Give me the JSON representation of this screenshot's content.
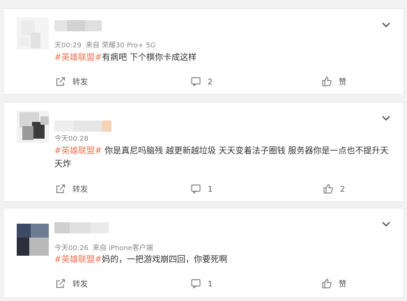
{
  "posts": [
    {
      "time": "天00:29",
      "source": "来自 荣耀30 Pro+ 5G",
      "topic": "#英雄联盟#",
      "text": "有病吧 下个棋你卡成这样",
      "actions": {
        "repost_label": "转发",
        "comment_count": "2",
        "like_label": "赞"
      }
    },
    {
      "time": "今天00:28",
      "source": "",
      "topic": "#英雄联盟#",
      "text": " 你是真尼吗脑残 越更新越垃圾 天天变着法子圈钱 服务器你是一点也不提升天天炸",
      "actions": {
        "repost_label": "转发",
        "comment_count": "1",
        "like_label": "2"
      }
    },
    {
      "time": "今天00:26",
      "source": "来自 iPhone客户端",
      "topic": "#英雄联盟#",
      "text": "妈的，一把游戏崩四回，你要死啊",
      "actions": {
        "repost_label": "转发",
        "comment_count": "1",
        "like_label": "赞"
      }
    }
  ],
  "icons": {
    "chevron": "chevron-down-icon",
    "repost": "repost-icon",
    "comment": "comment-icon",
    "like": "like-icon"
  },
  "colors": {
    "topic": "#eb7350",
    "meta": "#888888",
    "icon": "#777777"
  }
}
